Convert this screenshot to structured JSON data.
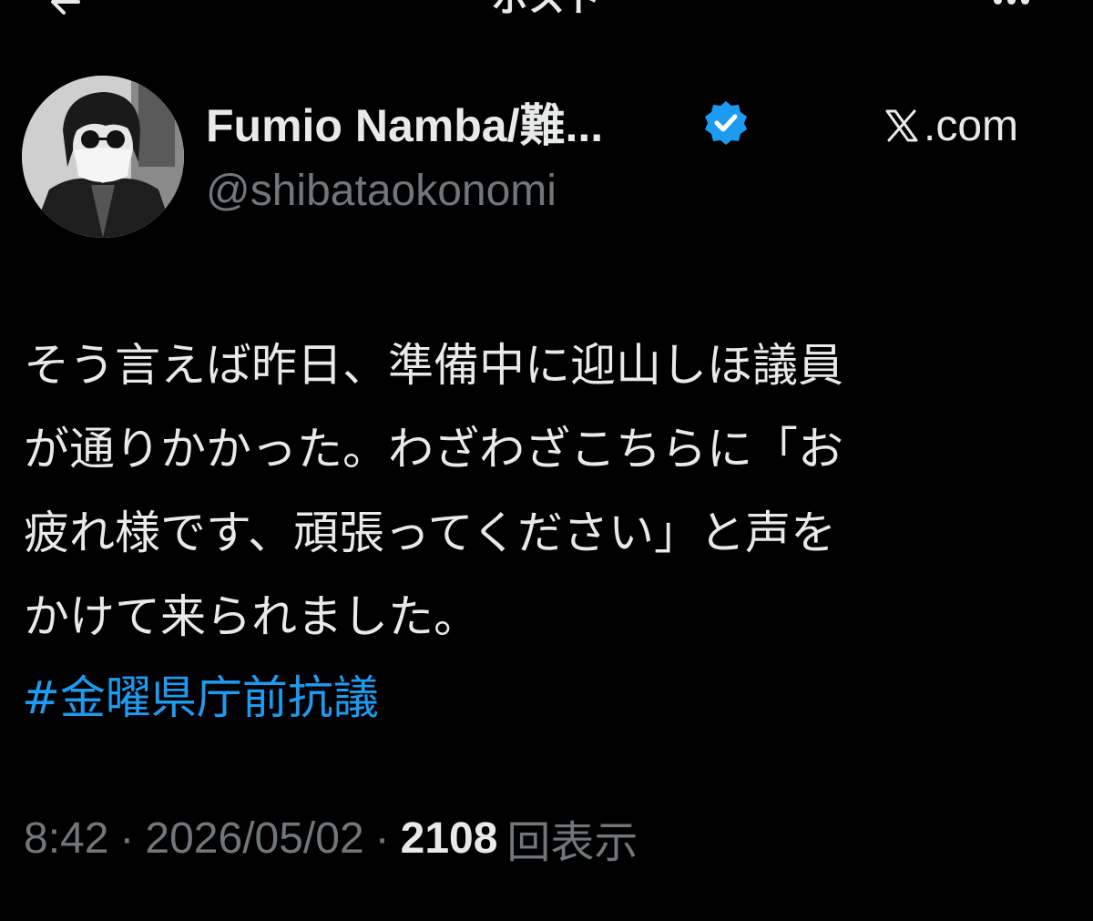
{
  "header": {
    "title": "ポスト",
    "back_icon": "arrow-left-icon",
    "more_icon": "more-dots-icon"
  },
  "author": {
    "display_name": "Fumio Namba/難...",
    "handle": "@shibataokonomi",
    "verified": true,
    "badge_color": "#1d9bf0",
    "source_label": ".com",
    "source_icon": "x-logo-icon"
  },
  "tweet": {
    "lines": [
      "そう言えば昨日、準備中に迎山しほ議員",
      "が通りかかった。わざわざこちらに「お",
      "疲れ様です、頑張ってください」と声を",
      "かけて来られました。"
    ],
    "hashtag": "#金曜県庁前抗議",
    "hashtag_color": "#1d9bf0"
  },
  "meta": {
    "time": "8:42",
    "separator": "·",
    "date": "2026/05/02",
    "views_count": "2108",
    "views_label": "回表示"
  },
  "colors": {
    "background": "#000000",
    "text_primary": "#e7e9ea",
    "text_secondary": "#71767b"
  }
}
